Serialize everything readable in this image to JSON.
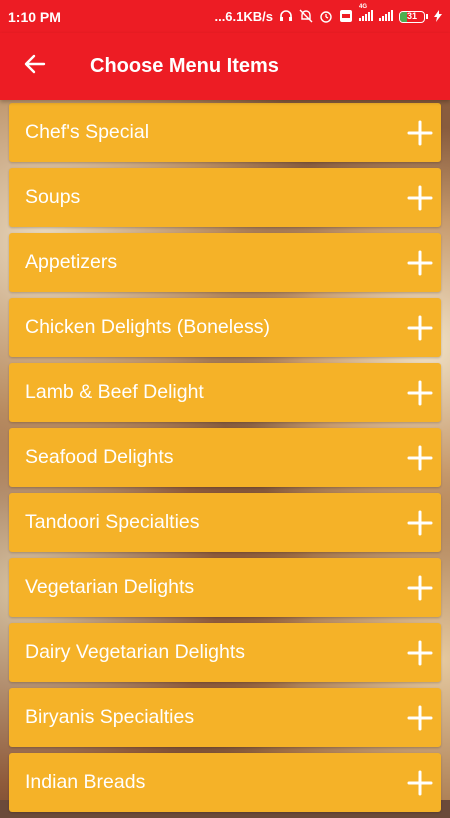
{
  "status_bar": {
    "time": "1:10 PM",
    "speed": "...6.1KB/s",
    "network_label": "4G",
    "battery_level": "31",
    "battery_fraction": 0.31
  },
  "header": {
    "title": "Choose Menu Items",
    "back_icon": "arrow-left-icon"
  },
  "menu": {
    "items": [
      {
        "label": "Chef's Special"
      },
      {
        "label": "Soups"
      },
      {
        "label": "Appetizers"
      },
      {
        "label": "Chicken Delights (Boneless)"
      },
      {
        "label": "Lamb & Beef Delight"
      },
      {
        "label": "Seafood Delights"
      },
      {
        "label": "Tandoori Specialties"
      },
      {
        "label": "Vegetarian Delights"
      },
      {
        "label": "Dairy Vegetarian Delights"
      },
      {
        "label": "Biryanis Specialties"
      },
      {
        "label": "Indian Breads"
      }
    ],
    "expand_icon": "plus-icon"
  },
  "colors": {
    "primary": "#ed1c24",
    "item_background": "#f5b228",
    "text": "#ffffff"
  }
}
